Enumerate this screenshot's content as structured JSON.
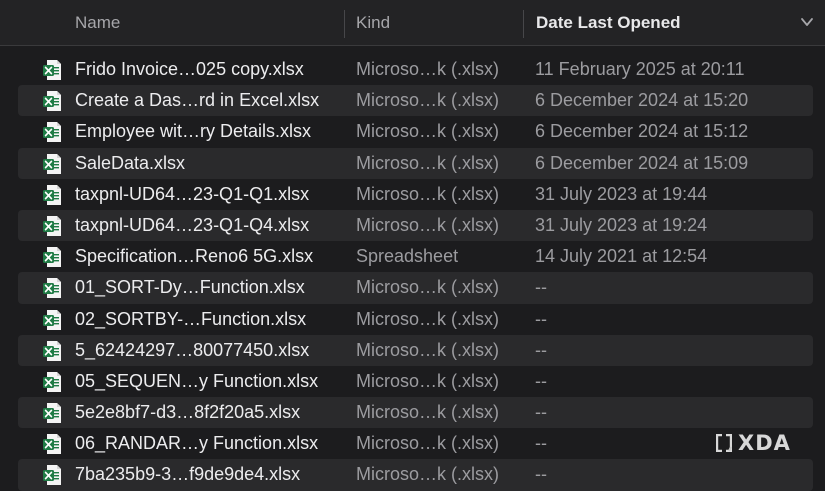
{
  "columns": {
    "name": "Name",
    "kind": "Kind",
    "date": "Date Last Opened"
  },
  "icon": "excel-file-icon",
  "accent": {
    "excel_green": "#1f7b45",
    "header_bg": "#232325",
    "row_alt": "#2a2a2c"
  },
  "files": [
    {
      "name": "Frido Invoice…025 copy.xlsx",
      "kind": "Microso…k (.xlsx)",
      "date": "11 February 2025 at 20:11"
    },
    {
      "name": "Create a Das…rd in Excel.xlsx",
      "kind": "Microso…k (.xlsx)",
      "date": "6 December 2024 at 15:20"
    },
    {
      "name": "Employee wit…ry Details.xlsx",
      "kind": "Microso…k (.xlsx)",
      "date": "6 December 2024 at 15:12"
    },
    {
      "name": "SaleData.xlsx",
      "kind": "Microso…k (.xlsx)",
      "date": "6 December 2024 at 15:09"
    },
    {
      "name": "taxpnl-UD64…23-Q1-Q1.xlsx",
      "kind": "Microso…k (.xlsx)",
      "date": "31 July 2023 at 19:44"
    },
    {
      "name": "taxpnl-UD64…23-Q1-Q4.xlsx",
      "kind": "Microso…k (.xlsx)",
      "date": "31 July 2023 at 19:24"
    },
    {
      "name": "Specification…Reno6 5G.xlsx",
      "kind": "Spreadsheet",
      "date": "14 July 2021 at 12:54"
    },
    {
      "name": "01_SORT-Dy…Function.xlsx",
      "kind": "Microso…k (.xlsx)",
      "date": "--"
    },
    {
      "name": "02_SORTBY-…Function.xlsx",
      "kind": "Microso…k (.xlsx)",
      "date": "--"
    },
    {
      "name": "5_62424297…80077450.xlsx",
      "kind": "Microso…k (.xlsx)",
      "date": "--"
    },
    {
      "name": "05_SEQUEN…y Function.xlsx",
      "kind": "Microso…k (.xlsx)",
      "date": "--"
    },
    {
      "name": "5e2e8bf7-d3…8f2f20a5.xlsx",
      "kind": "Microso…k (.xlsx)",
      "date": "--"
    },
    {
      "name": "06_RANDAR…y Function.xlsx",
      "kind": "Microso…k (.xlsx)",
      "date": "--"
    },
    {
      "name": "7ba235b9-3…f9de9de4.xlsx",
      "kind": "Microso…k (.xlsx)",
      "date": "--"
    }
  ],
  "watermark": {
    "text": "XDA",
    "icon": "xda-bracket-icon"
  }
}
